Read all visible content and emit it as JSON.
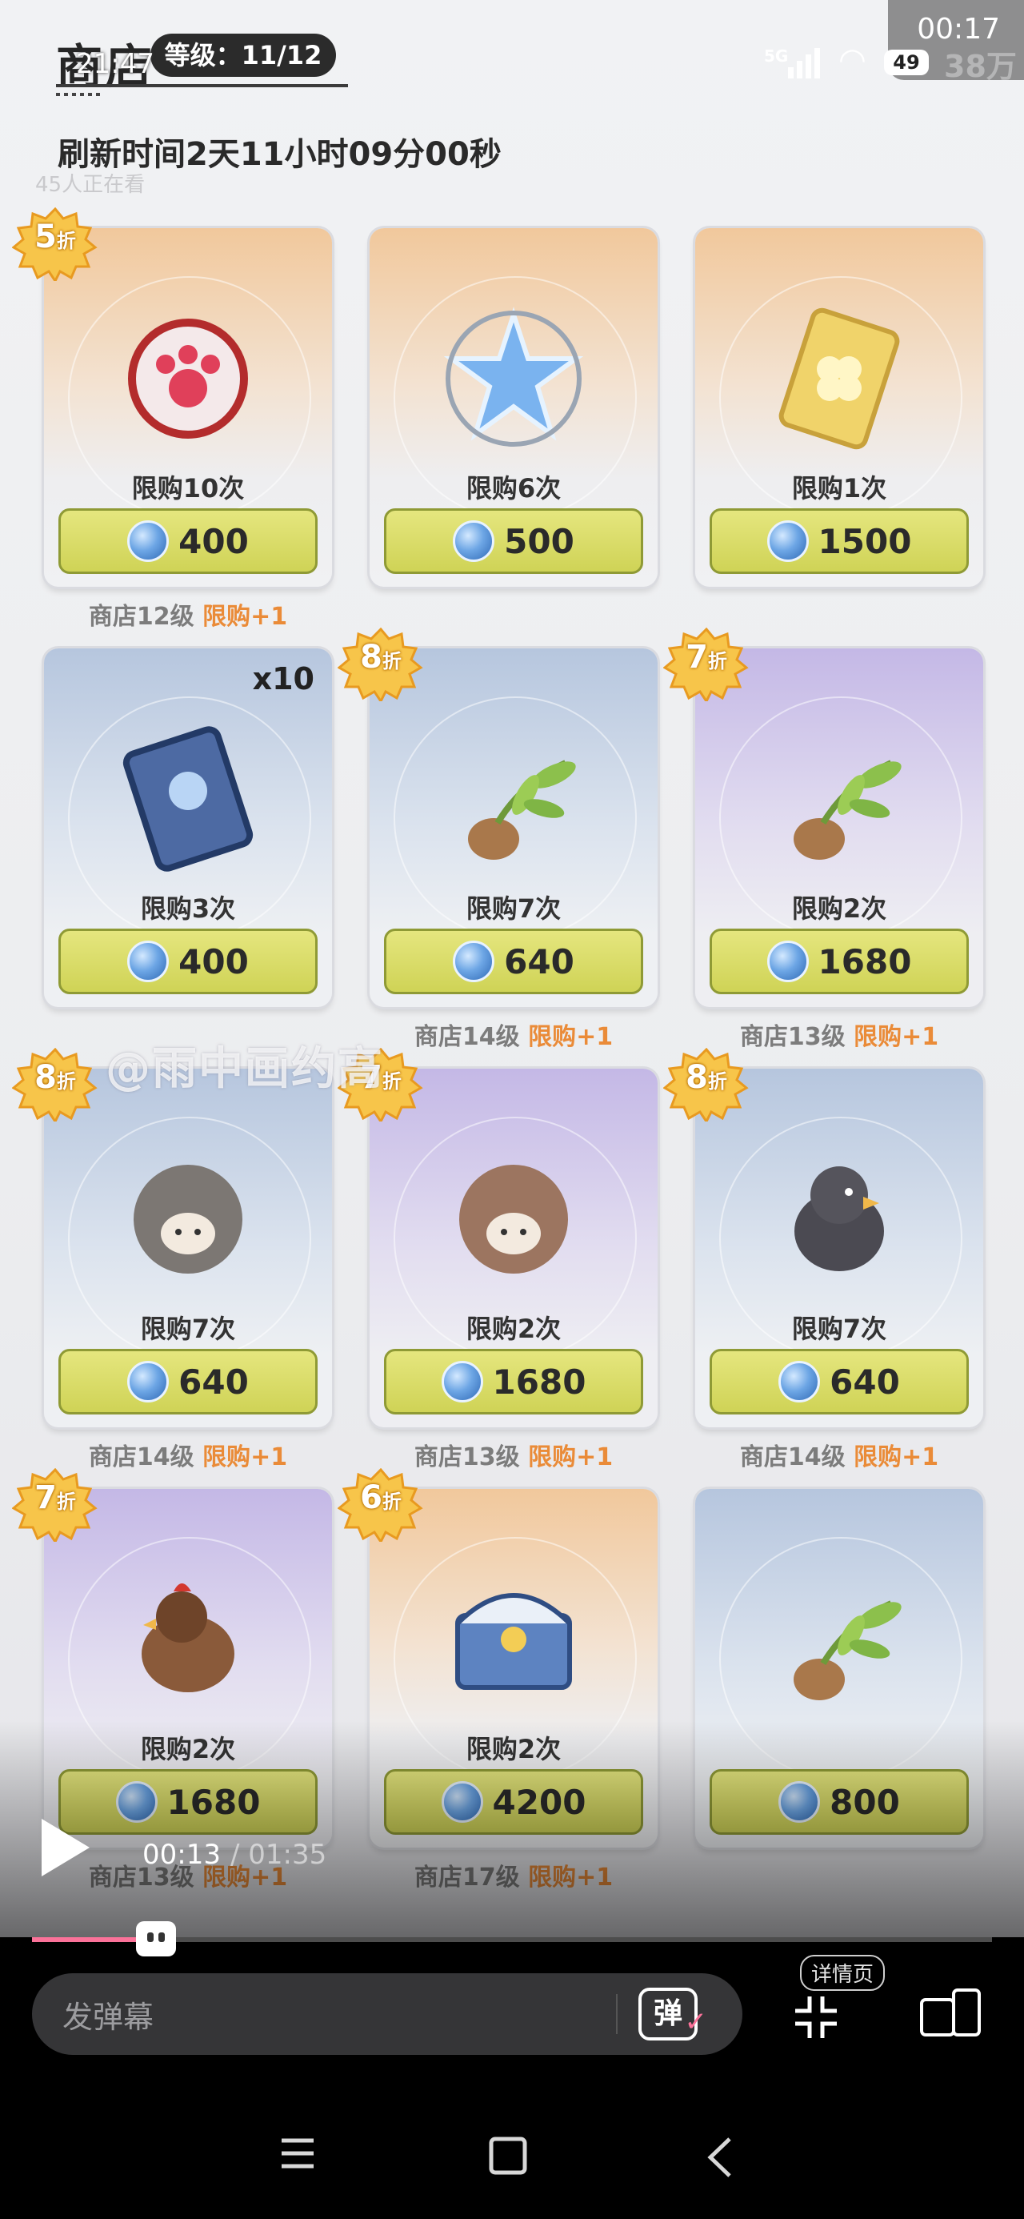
{
  "header": {
    "title": "商店",
    "level": "等级：11/12",
    "refresh": "刷新时间2天11小时09分00秒",
    "watching": "45人正在看"
  },
  "status_bar": {
    "time_left": "21:47",
    "time_right": "00:17",
    "network": "5G",
    "battery": "49",
    "ghost_text": "38万"
  },
  "watermark": "@雨中画约高",
  "items": [
    {
      "limit": "限购10次",
      "price": "400",
      "discount": "5",
      "note": "商店12级",
      "note_up": "限购+1",
      "bg": "orange",
      "icon": "paw-charm-icon"
    },
    {
      "limit": "限购6次",
      "price": "500",
      "discount": "",
      "note": "",
      "note_up": "",
      "bg": "orange",
      "icon": "crystal-star-icon"
    },
    {
      "limit": "限购1次",
      "price": "1500",
      "discount": "",
      "note": "",
      "note_up": "",
      "bg": "orange",
      "icon": "clover-card-icon"
    },
    {
      "limit": "限购3次",
      "price": "400",
      "discount": "",
      "qty": "x10",
      "note": "",
      "note_up": "",
      "bg": "blue",
      "icon": "character-card-icon"
    },
    {
      "limit": "限购7次",
      "price": "640",
      "discount": "8",
      "note": "商店14级",
      "note_up": "限购+1",
      "bg": "blue",
      "icon": "sprout-icon"
    },
    {
      "limit": "限购2次",
      "price": "1680",
      "discount": "7",
      "note": "商店13级",
      "note_up": "限购+1",
      "bg": "purple",
      "icon": "sprout-icon"
    },
    {
      "limit": "限购7次",
      "price": "640",
      "discount": "8",
      "note": "商店14级",
      "note_up": "限购+1",
      "bg": "blue",
      "icon": "gray-sheep-icon"
    },
    {
      "limit": "限购2次",
      "price": "1680",
      "discount": "7",
      "note": "商店13级",
      "note_up": "限购+1",
      "bg": "purple",
      "icon": "brown-sheep-icon"
    },
    {
      "limit": "限购7次",
      "price": "640",
      "discount": "8",
      "note": "商店14级",
      "note_up": "限购+1",
      "bg": "blue",
      "icon": "crow-icon"
    },
    {
      "limit": "限购2次",
      "price": "1680",
      "discount": "7",
      "note": "商店13级",
      "note_up": "限购+1",
      "bg": "purple",
      "icon": "hen-icon"
    },
    {
      "limit": "限购2次",
      "price": "4200",
      "discount": "6",
      "note": "商店17级",
      "note_up": "限购+1",
      "bg": "orange",
      "icon": "treasure-chest-icon"
    },
    {
      "limit": "",
      "price": "800",
      "discount": "",
      "note": "",
      "note_up": "",
      "bg": "blue",
      "icon": "sprout-icon"
    }
  ],
  "discount_suffix": "折",
  "player": {
    "current": "00:13",
    "total": "/ 01:35",
    "progress": 0.137
  },
  "bottom": {
    "danmu_placeholder": "发弹幕",
    "danmu_icon_text": "弹",
    "detail_label": "详情页"
  },
  "colors": {
    "accent_pink": "#fb7299",
    "price_green": "#d3d75c",
    "note_orange": "#ea8b38"
  }
}
